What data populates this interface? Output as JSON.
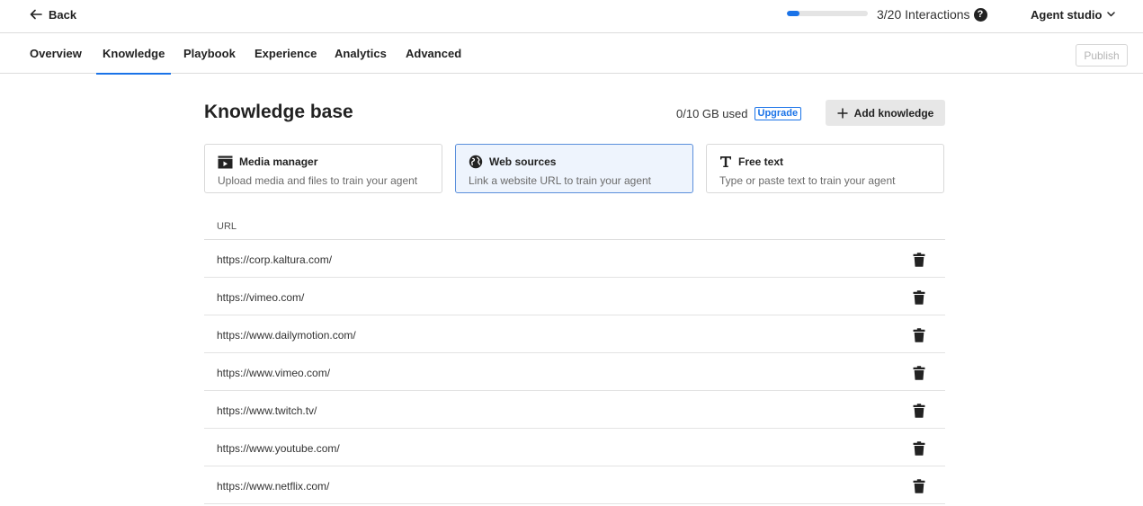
{
  "topbar": {
    "back_label": "Back",
    "progress": {
      "used": 3,
      "total": 20
    },
    "interactions_label": "3/20 Interactions",
    "studio_label": "Agent studio"
  },
  "tabs": [
    {
      "label": "Overview",
      "active": false
    },
    {
      "label": "Knowledge",
      "active": true
    },
    {
      "label": "Playbook",
      "active": false
    },
    {
      "label": "Experience",
      "active": false
    },
    {
      "label": "Analytics",
      "active": false
    },
    {
      "label": "Advanced",
      "active": false
    }
  ],
  "publish_label": "Publish",
  "knowledge": {
    "title": "Knowledge base",
    "usage": "0/10 GB used",
    "upgrade_label": "Upgrade",
    "add_label": "Add knowledge"
  },
  "sources": [
    {
      "title": "Media manager",
      "desc": "Upload media and files to train your agent",
      "icon": "media-icon",
      "selected": false
    },
    {
      "title": "Web sources",
      "desc": "Link a website URL to train your agent",
      "icon": "globe-icon",
      "selected": true
    },
    {
      "title": "Free text",
      "desc": "Type or paste text to train your agent",
      "icon": "text-icon",
      "selected": false
    }
  ],
  "table": {
    "header": "URL",
    "rows": [
      "https://corp.kaltura.com/",
      "https://vimeo.com/",
      "https://www.dailymotion.com/",
      "https://www.vimeo.com/",
      "https://www.twitch.tv/",
      "https://www.youtube.com/",
      "https://www.netflix.com/"
    ]
  },
  "colors": {
    "accent": "#1a73e8",
    "selected_bg": "#eef4fd"
  }
}
